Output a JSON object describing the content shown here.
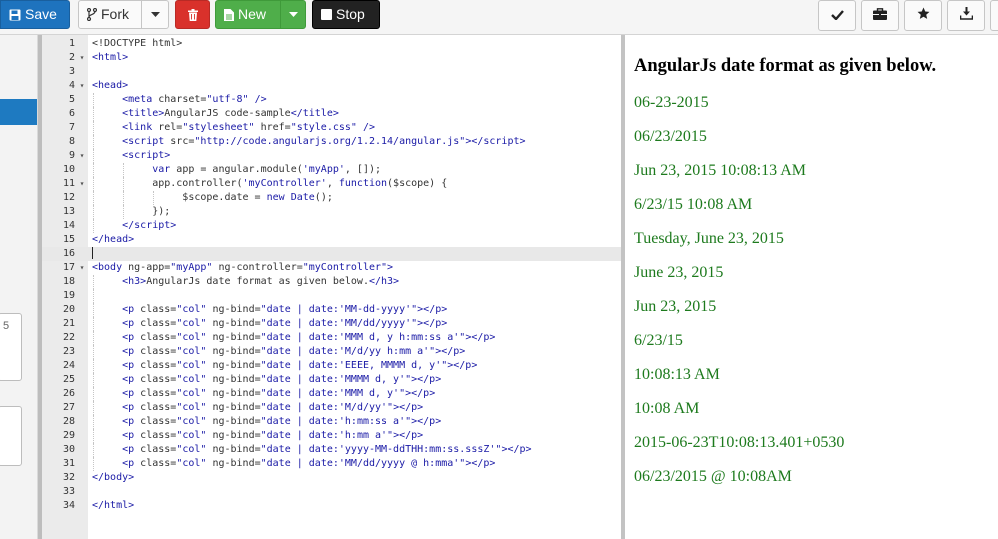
{
  "toolbar": {
    "save_label": "Save",
    "fork_label": "Fork",
    "new_label": "New",
    "stop_label": "Stop",
    "right_icons": [
      "check-icon",
      "briefcase-icon",
      "star-icon",
      "download-icon"
    ]
  },
  "sidebar": {
    "textarea_value": "5"
  },
  "editor": {
    "active_line": 16,
    "lines": [
      {
        "n": "1",
        "fold": "",
        "guides": 0,
        "html": "<span class=\"pl\">&lt;!DOCTYPE html&gt;</span>"
      },
      {
        "n": "2",
        "fold": "▾",
        "guides": 0,
        "html": "<span class=\"tg\">&lt;html&gt;</span>"
      },
      {
        "n": "3",
        "fold": "",
        "guides": 0,
        "html": ""
      },
      {
        "n": "4",
        "fold": "▾",
        "guides": 0,
        "html": "<span class=\"tg\">&lt;head&gt;</span>"
      },
      {
        "n": "5",
        "fold": "",
        "guides": 1,
        "html": "     <span class=\"tg\">&lt;meta</span> charset=<span class=\"st\">\"utf-8\"</span> <span class=\"tg\">/&gt;</span>"
      },
      {
        "n": "6",
        "fold": "",
        "guides": 1,
        "html": "     <span class=\"tg\">&lt;title&gt;</span>AngularJS code-sample<span class=\"tg\">&lt;/title&gt;</span>"
      },
      {
        "n": "7",
        "fold": "",
        "guides": 1,
        "html": "     <span class=\"tg\">&lt;link</span> rel=<span class=\"st\">\"stylesheet\"</span> href=<span class=\"st\">\"style.css\"</span> <span class=\"tg\">/&gt;</span>"
      },
      {
        "n": "8",
        "fold": "",
        "guides": 1,
        "html": "     <span class=\"tg\">&lt;script</span> src=<span class=\"st\">\"http://code.angularjs.org/1.2.14/angular.js\"</span><span class=\"tg\">&gt;&lt;/script&gt;</span>"
      },
      {
        "n": "9",
        "fold": "▾",
        "guides": 1,
        "html": "     <span class=\"tg\">&lt;script&gt;</span>"
      },
      {
        "n": "10",
        "fold": "",
        "guides": 2,
        "html": "          <span class=\"kw\">var</span> app = angular.module(<span class=\"st\">'myApp'</span>, []);"
      },
      {
        "n": "11",
        "fold": "▾",
        "guides": 2,
        "html": "          app.controller(<span class=\"st\">'myController'</span>, <span class=\"kw\">function</span>($scope) {"
      },
      {
        "n": "12",
        "fold": "",
        "guides": 3,
        "html": "               $scope.date = <span class=\"kw\">new</span> <span class=\"kw\">Date</span>();"
      },
      {
        "n": "13",
        "fold": "",
        "guides": 2,
        "html": "          });"
      },
      {
        "n": "14",
        "fold": "",
        "guides": 1,
        "html": "     <span class=\"tg\">&lt;/script&gt;</span>"
      },
      {
        "n": "15",
        "fold": "",
        "guides": 0,
        "html": "<span class=\"tg\">&lt;/head&gt;</span>"
      },
      {
        "n": "16",
        "fold": "",
        "guides": 0,
        "html": "<span class=\"cur\"></span>"
      },
      {
        "n": "17",
        "fold": "▾",
        "guides": 0,
        "html": "<span class=\"tg\">&lt;body</span> ng-app=<span class=\"st\">\"myApp\"</span> ng-controller=<span class=\"st\">\"myController\"</span><span class=\"tg\">&gt;</span>"
      },
      {
        "n": "18",
        "fold": "",
        "guides": 1,
        "html": "     <span class=\"tg\">&lt;h3&gt;</span>AngularJs date format as given below.<span class=\"tg\">&lt;/h3&gt;</span>"
      },
      {
        "n": "19",
        "fold": "",
        "guides": 1,
        "html": ""
      },
      {
        "n": "20",
        "fold": "",
        "guides": 1,
        "html": "     <span class=\"tg\">&lt;p</span> class=<span class=\"st\">\"col\"</span> ng-bind=<span class=\"st\">\"date | date:'MM-dd-yyyy'\"</span><span class=\"tg\">&gt;&lt;/p&gt;</span>"
      },
      {
        "n": "21",
        "fold": "",
        "guides": 1,
        "html": "     <span class=\"tg\">&lt;p</span> class=<span class=\"st\">\"col\"</span> ng-bind=<span class=\"st\">\"date | date:'MM/dd/yyyy'\"</span><span class=\"tg\">&gt;&lt;/p&gt;</span>"
      },
      {
        "n": "22",
        "fold": "",
        "guides": 1,
        "html": "     <span class=\"tg\">&lt;p</span> class=<span class=\"st\">\"col\"</span> ng-bind=<span class=\"st\">\"date | date:'MMM d, y h:mm:ss a'\"</span><span class=\"tg\">&gt;&lt;/p&gt;</span>"
      },
      {
        "n": "23",
        "fold": "",
        "guides": 1,
        "html": "     <span class=\"tg\">&lt;p</span> class=<span class=\"st\">\"col\"</span> ng-bind=<span class=\"st\">\"date | date:'M/d/yy h:mm a'\"</span><span class=\"tg\">&gt;&lt;/p&gt;</span>"
      },
      {
        "n": "24",
        "fold": "",
        "guides": 1,
        "html": "     <span class=\"tg\">&lt;p</span> class=<span class=\"st\">\"col\"</span> ng-bind=<span class=\"st\">\"date | date:'EEEE, MMMM d, y'\"</span><span class=\"tg\">&gt;&lt;/p&gt;</span>"
      },
      {
        "n": "25",
        "fold": "",
        "guides": 1,
        "html": "     <span class=\"tg\">&lt;p</span> class=<span class=\"st\">\"col\"</span> ng-bind=<span class=\"st\">\"date | date:'MMMM d, y'\"</span><span class=\"tg\">&gt;&lt;/p&gt;</span>"
      },
      {
        "n": "26",
        "fold": "",
        "guides": 1,
        "html": "     <span class=\"tg\">&lt;p</span> class=<span class=\"st\">\"col\"</span> ng-bind=<span class=\"st\">\"date | date:'MMM d, y'\"</span><span class=\"tg\">&gt;&lt;/p&gt;</span>"
      },
      {
        "n": "27",
        "fold": "",
        "guides": 1,
        "html": "     <span class=\"tg\">&lt;p</span> class=<span class=\"st\">\"col\"</span> ng-bind=<span class=\"st\">\"date | date:'M/d/yy'\"</span><span class=\"tg\">&gt;&lt;/p&gt;</span>"
      },
      {
        "n": "28",
        "fold": "",
        "guides": 1,
        "html": "     <span class=\"tg\">&lt;p</span> class=<span class=\"st\">\"col\"</span> ng-bind=<span class=\"st\">\"date | date:'h:mm:ss a'\"</span><span class=\"tg\">&gt;&lt;/p&gt;</span>"
      },
      {
        "n": "29",
        "fold": "",
        "guides": 1,
        "html": "     <span class=\"tg\">&lt;p</span> class=<span class=\"st\">\"col\"</span> ng-bind=<span class=\"st\">\"date | date:'h:mm a'\"</span><span class=\"tg\">&gt;&lt;/p&gt;</span>"
      },
      {
        "n": "30",
        "fold": "",
        "guides": 1,
        "html": "     <span class=\"tg\">&lt;p</span> class=<span class=\"st\">\"col\"</span> ng-bind=<span class=\"st\">\"date | date:'yyyy-MM-ddTHH:mm:ss.sssZ'\"</span><span class=\"tg\">&gt;&lt;/p&gt;</span>"
      },
      {
        "n": "31",
        "fold": "",
        "guides": 1,
        "html": "     <span class=\"tg\">&lt;p</span> class=<span class=\"st\">\"col\"</span> ng-bind=<span class=\"st\">\"date | date:'MM/dd/yyyy @ h:mma'\"</span><span class=\"tg\">&gt;&lt;/p&gt;</span>"
      },
      {
        "n": "32",
        "fold": "",
        "guides": 0,
        "html": "<span class=\"tg\">&lt;/body&gt;</span>"
      },
      {
        "n": "33",
        "fold": "",
        "guides": 0,
        "html": ""
      },
      {
        "n": "34",
        "fold": "",
        "guides": 0,
        "html": "<span class=\"tg\">&lt;/html&gt;</span>"
      }
    ]
  },
  "preview": {
    "title": "AngularJs date format as given below.",
    "items": [
      "06-23-2015",
      "06/23/2015",
      "Jun 23, 2015 10:08:13 AM",
      "6/23/15 10:08 AM",
      "Tuesday, June 23, 2015",
      "June 23, 2015",
      "Jun 23, 2015",
      "6/23/15",
      "10:08:13 AM",
      "10:08 AM",
      "2015-06-23T10:08:13.401+0530",
      "06/23/2015 @ 10:08AM"
    ]
  },
  "colors": {
    "save": "#1e73be",
    "delete": "#d9312b",
    "new": "#4fae4a",
    "stop": "#222222",
    "preview_text": "#1d7a1d"
  }
}
